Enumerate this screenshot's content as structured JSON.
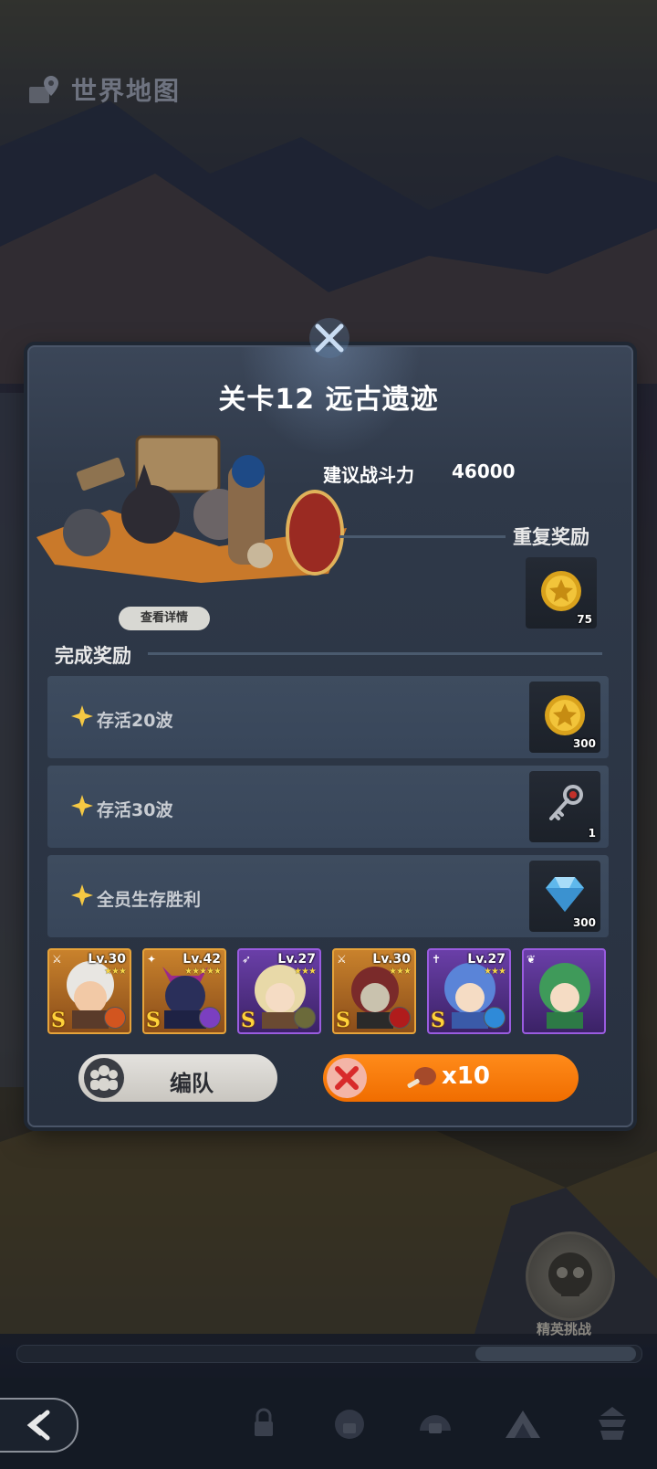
{
  "header": {
    "title": "世界地图",
    "icon": "map-pin-icon"
  },
  "stage": {
    "title": "关卡12 远古遗迹",
    "details_label": "查看详情",
    "power_label": "建议战斗力",
    "power_value": "46000"
  },
  "repeat_reward": {
    "label": "重复奖励",
    "item": {
      "icon": "gold-coin-icon",
      "qty": "75"
    }
  },
  "complete_reward": {
    "label": "完成奖励",
    "tasks": [
      {
        "text": "存活20波",
        "icon": "gold-coin-icon",
        "qty": "300"
      },
      {
        "text": "存活30波",
        "icon": "key-icon",
        "qty": "1"
      },
      {
        "text": "全员生存胜利",
        "icon": "diamond-icon",
        "qty": "300"
      }
    ]
  },
  "heroes": [
    {
      "level": "Lv.30",
      "stars": "★★★",
      "rank": "S",
      "frame": "gold",
      "element": "fire",
      "class": "warrior"
    },
    {
      "level": "Lv.42",
      "stars": "★★★★★",
      "rank": "S",
      "frame": "gold",
      "element": "moon",
      "class": "mage"
    },
    {
      "level": "Lv.27",
      "stars": "★★★",
      "rank": "S",
      "frame": "purple",
      "element": "light",
      "class": "archer"
    },
    {
      "level": "Lv.30",
      "stars": "★★★",
      "rank": "S",
      "frame": "gold",
      "element": "blood",
      "class": "assassin"
    },
    {
      "level": "Lv.27",
      "stars": "★★★",
      "rank": "S",
      "frame": "purple",
      "element": "ice",
      "class": "healer"
    },
    {
      "level": "",
      "stars": "",
      "rank": "",
      "frame": "purple",
      "element": "",
      "class": "support"
    }
  ],
  "actions": {
    "formation_label": "编队",
    "battle_cost": "x10",
    "battle_cost_icon": "meat-icon"
  },
  "elite": {
    "label": "精英挑战"
  },
  "colors": {
    "accent_orange": "#f27a0a",
    "panel": "#2f3949",
    "gold_frame": "#e6a33a",
    "purple_frame": "#9a5ce0"
  }
}
